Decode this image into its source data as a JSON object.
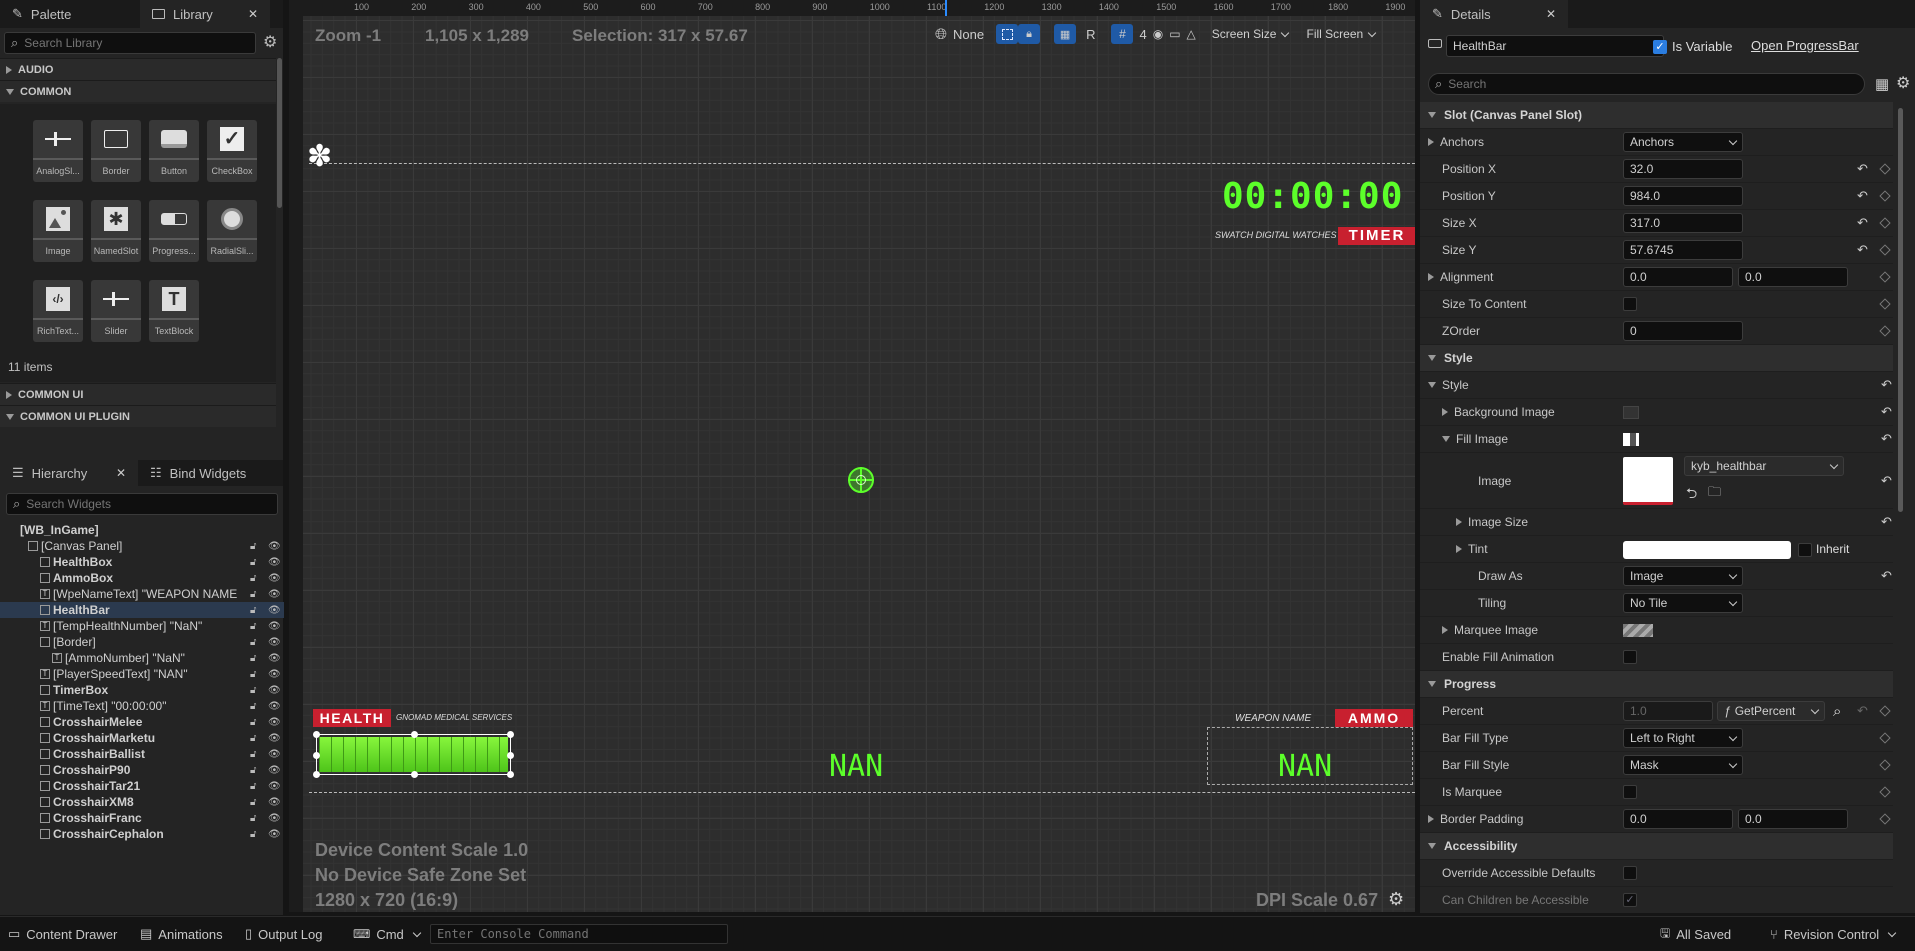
{
  "palette": {
    "tab_palette": "Palette",
    "tab_library": "Library",
    "search_placeholder": "Search Library",
    "categories": [
      "AUDIO",
      "COMMON",
      "COMMON UI",
      "COMMON UI PLUGIN"
    ],
    "tiles": [
      {
        "label": "AnalogSl...",
        "icon": "analog-slider-icon"
      },
      {
        "label": "Border",
        "icon": "border-icon"
      },
      {
        "label": "Button",
        "icon": "button-icon"
      },
      {
        "label": "CheckBox",
        "icon": "checkbox-icon"
      },
      {
        "label": "Image",
        "icon": "image-icon"
      },
      {
        "label": "NamedSlot",
        "icon": "named-slot-icon"
      },
      {
        "label": "Progress...",
        "icon": "progress-bar-icon"
      },
      {
        "label": "RadialSli...",
        "icon": "radial-slider-icon"
      },
      {
        "label": "RichText...",
        "icon": "rich-text-icon"
      },
      {
        "label": "Slider",
        "icon": "slider-icon"
      },
      {
        "label": "TextBlock",
        "icon": "text-block-icon"
      }
    ],
    "items_count": "11 items"
  },
  "hierarchy": {
    "tab_hierarchy": "Hierarchy",
    "tab_bind": "Bind Widgets",
    "search_placeholder": "Search Widgets",
    "root": "[WB_InGame]",
    "rows": [
      {
        "label": "[Canvas Panel]",
        "bold": false,
        "indent": 1
      },
      {
        "label": "HealthBox",
        "bold": true,
        "indent": 2
      },
      {
        "label": "AmmoBox",
        "bold": true,
        "indent": 2
      },
      {
        "label": "[WpeNameText] \"WEAPON NAME",
        "bold": false,
        "indent": 2
      },
      {
        "label": "HealthBar",
        "bold": true,
        "indent": 2
      },
      {
        "label": "[TempHealthNumber] \"NaN\"",
        "bold": false,
        "indent": 2
      },
      {
        "label": "[Border]",
        "bold": false,
        "indent": 2
      },
      {
        "label": "[AmmoNumber] \"NaN\"",
        "bold": false,
        "indent": 3
      },
      {
        "label": "[PlayerSpeedText] \"NAN\"",
        "bold": false,
        "indent": 2
      },
      {
        "label": "TimerBox",
        "bold": true,
        "indent": 2
      },
      {
        "label": "[TimeText] \"00:00:00\"",
        "bold": false,
        "indent": 2
      },
      {
        "label": "CrosshairMelee",
        "bold": true,
        "indent": 2
      },
      {
        "label": "CrosshairMarketu",
        "bold": true,
        "indent": 2
      },
      {
        "label": "CrosshairBallist",
        "bold": true,
        "indent": 2
      },
      {
        "label": "CrosshairP90",
        "bold": true,
        "indent": 2
      },
      {
        "label": "CrosshairTar21",
        "bold": true,
        "indent": 2
      },
      {
        "label": "CrosshairXM8",
        "bold": true,
        "indent": 2
      },
      {
        "label": "CrosshairFranc",
        "bold": true,
        "indent": 2
      },
      {
        "label": "CrosshairCephalon",
        "bold": true,
        "indent": 2
      }
    ]
  },
  "viewport": {
    "zoom": "Zoom -1",
    "resolution": "1,105 x 1,289",
    "selection": "Selection: 317 x 57.67",
    "toolbar": {
      "none_label": "None",
      "r_label": "R",
      "grid_value": "4",
      "screen_size": "Screen Size",
      "fill_screen": "Fill Screen"
    },
    "ruler_ticks": [
      "100",
      "200",
      "300",
      "400",
      "500",
      "600",
      "700",
      "800",
      "900",
      "1000",
      "1100",
      "1200",
      "1300",
      "1400",
      "1500",
      "1600",
      "1700",
      "1800",
      "1900"
    ],
    "device_content_scale": "Device Content Scale 1.0",
    "safe_zone": "No Device Safe Zone Set",
    "resolution_label": "1280 x 720 (16:9)",
    "dpi_scale": "DPI Scale 0.67",
    "hud": {
      "timer_digits": "00:00:00",
      "timer_brand": "SWATCH DIGITAL WATCHES",
      "timer_label": "TIMER",
      "health_label": "HEALTH",
      "health_sub": "GNOMAD MEDICAL SERVICES",
      "speed_text": "NAN",
      "weapon_name": "WEAPON NAME",
      "ammo_label": "AMMO",
      "ammo_text": "NAN"
    }
  },
  "details": {
    "tab": "Details",
    "name_value": "HealthBar",
    "is_variable_label": "Is Variable",
    "open_link": "Open ProgressBar",
    "search_placeholder": "Search",
    "slot_header": "Slot (Canvas Panel Slot)",
    "anchors": {
      "label": "Anchors",
      "value": "Anchors"
    },
    "position_x": {
      "label": "Position X",
      "value": "32.0"
    },
    "position_y": {
      "label": "Position Y",
      "value": "984.0"
    },
    "size_x": {
      "label": "Size X",
      "value": "317.0"
    },
    "size_y": {
      "label": "Size Y",
      "value": "57.6745"
    },
    "alignment": {
      "label": "Alignment",
      "x": "0.0",
      "y": "0.0"
    },
    "size_to_content": "Size To Content",
    "zorder": {
      "label": "ZOrder",
      "value": "0"
    },
    "style_header": "Style",
    "style_sub": "Style",
    "background_image": "Background Image",
    "fill_image": "Fill Image",
    "image": {
      "label": "Image",
      "asset": "kyb_healthbar"
    },
    "image_size": "Image Size",
    "tint": {
      "label": "Tint",
      "inherit": "Inherit"
    },
    "draw_as": {
      "label": "Draw As",
      "value": "Image"
    },
    "tiling": {
      "label": "Tiling",
      "value": "No Tile"
    },
    "marquee_image": "Marquee Image",
    "enable_fill_animation": "Enable Fill Animation",
    "progress_header": "Progress",
    "percent": {
      "label": "Percent",
      "value": "1.0",
      "binding": "GetPercent"
    },
    "bar_fill_type": {
      "label": "Bar Fill Type",
      "value": "Left to Right"
    },
    "bar_fill_style": {
      "label": "Bar Fill Style",
      "value": "Mask"
    },
    "is_marquee": "Is Marquee",
    "border_padding": {
      "label": "Border Padding",
      "x": "0.0",
      "y": "0.0"
    },
    "accessibility_header": "Accessibility",
    "override_accessible": "Override Accessible Defaults",
    "can_children": "Can Children be Accessible"
  },
  "bottom": {
    "content_drawer": "Content Drawer",
    "animations": "Animations",
    "output_log": "Output Log",
    "cmd": "Cmd",
    "console_placeholder": "Enter Console Command",
    "all_saved": "All Saved",
    "revision_control": "Revision Control"
  },
  "colors": {
    "accent_red": "#c8202f",
    "lcd_green": "#5cff2a",
    "selection_blue": "#2b3a4f"
  }
}
